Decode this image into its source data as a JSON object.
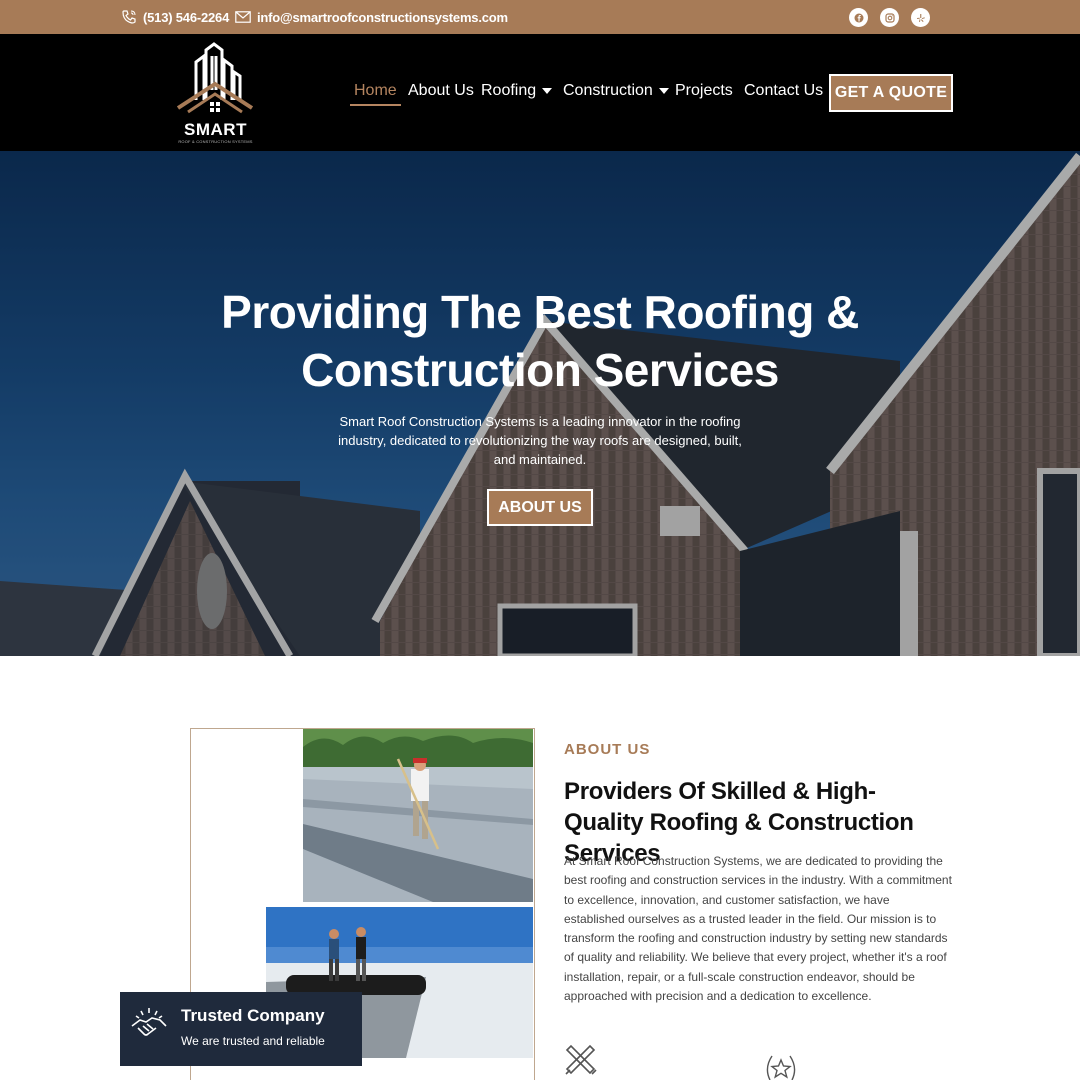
{
  "topbar": {
    "phone": "(513) 546-2264",
    "email": "info@smartroofconstructionsystems.com",
    "socials": [
      "facebook-icon",
      "instagram-icon",
      "yelp-icon"
    ]
  },
  "header": {
    "logo_text": "SMART",
    "logo_subtext": "ROOF & CONSTRUCTION SYSTEMS",
    "nav": [
      {
        "label": "Home",
        "active": true
      },
      {
        "label": "About Us"
      },
      {
        "label": "Roofing",
        "dropdown": true
      },
      {
        "label": "Construction",
        "dropdown": true
      },
      {
        "label": "Projects"
      },
      {
        "label": "Contact Us"
      }
    ],
    "cta": "GET A QUOTE"
  },
  "hero": {
    "title_line1": "Providing The Best Roofing &",
    "title_line2": "Construction Services",
    "description": "Smart Roof Construction Systems is a leading innovator in the roofing industry, dedicated to revolutionizing the way roofs are designed, built, and maintained.",
    "button": "ABOUT US"
  },
  "about": {
    "label": "ABOUT US",
    "title": "Providers Of Skilled & High-Quality Roofing & Construction Services",
    "body": "At Smart Roof Construction Systems, we are dedicated to providing the best roofing and construction services in the industry. With a commitment to excellence, innovation, and customer satisfaction, we have established ourselves as a trusted leader in the field. Our mission is to transform the roofing and construction industry by setting new standards of quality and reliability. We believe that every project, whether it's a roof installation, repair, or a full-scale construction endeavor, should be approached with precision and a dedication to excellence.",
    "badge_title": "Trusted Company",
    "badge_subtitle": "We are trusted and reliable"
  },
  "colors": {
    "accent": "#a77b57",
    "header_bg": "#000000",
    "badge_bg": "#1f2a3c"
  }
}
